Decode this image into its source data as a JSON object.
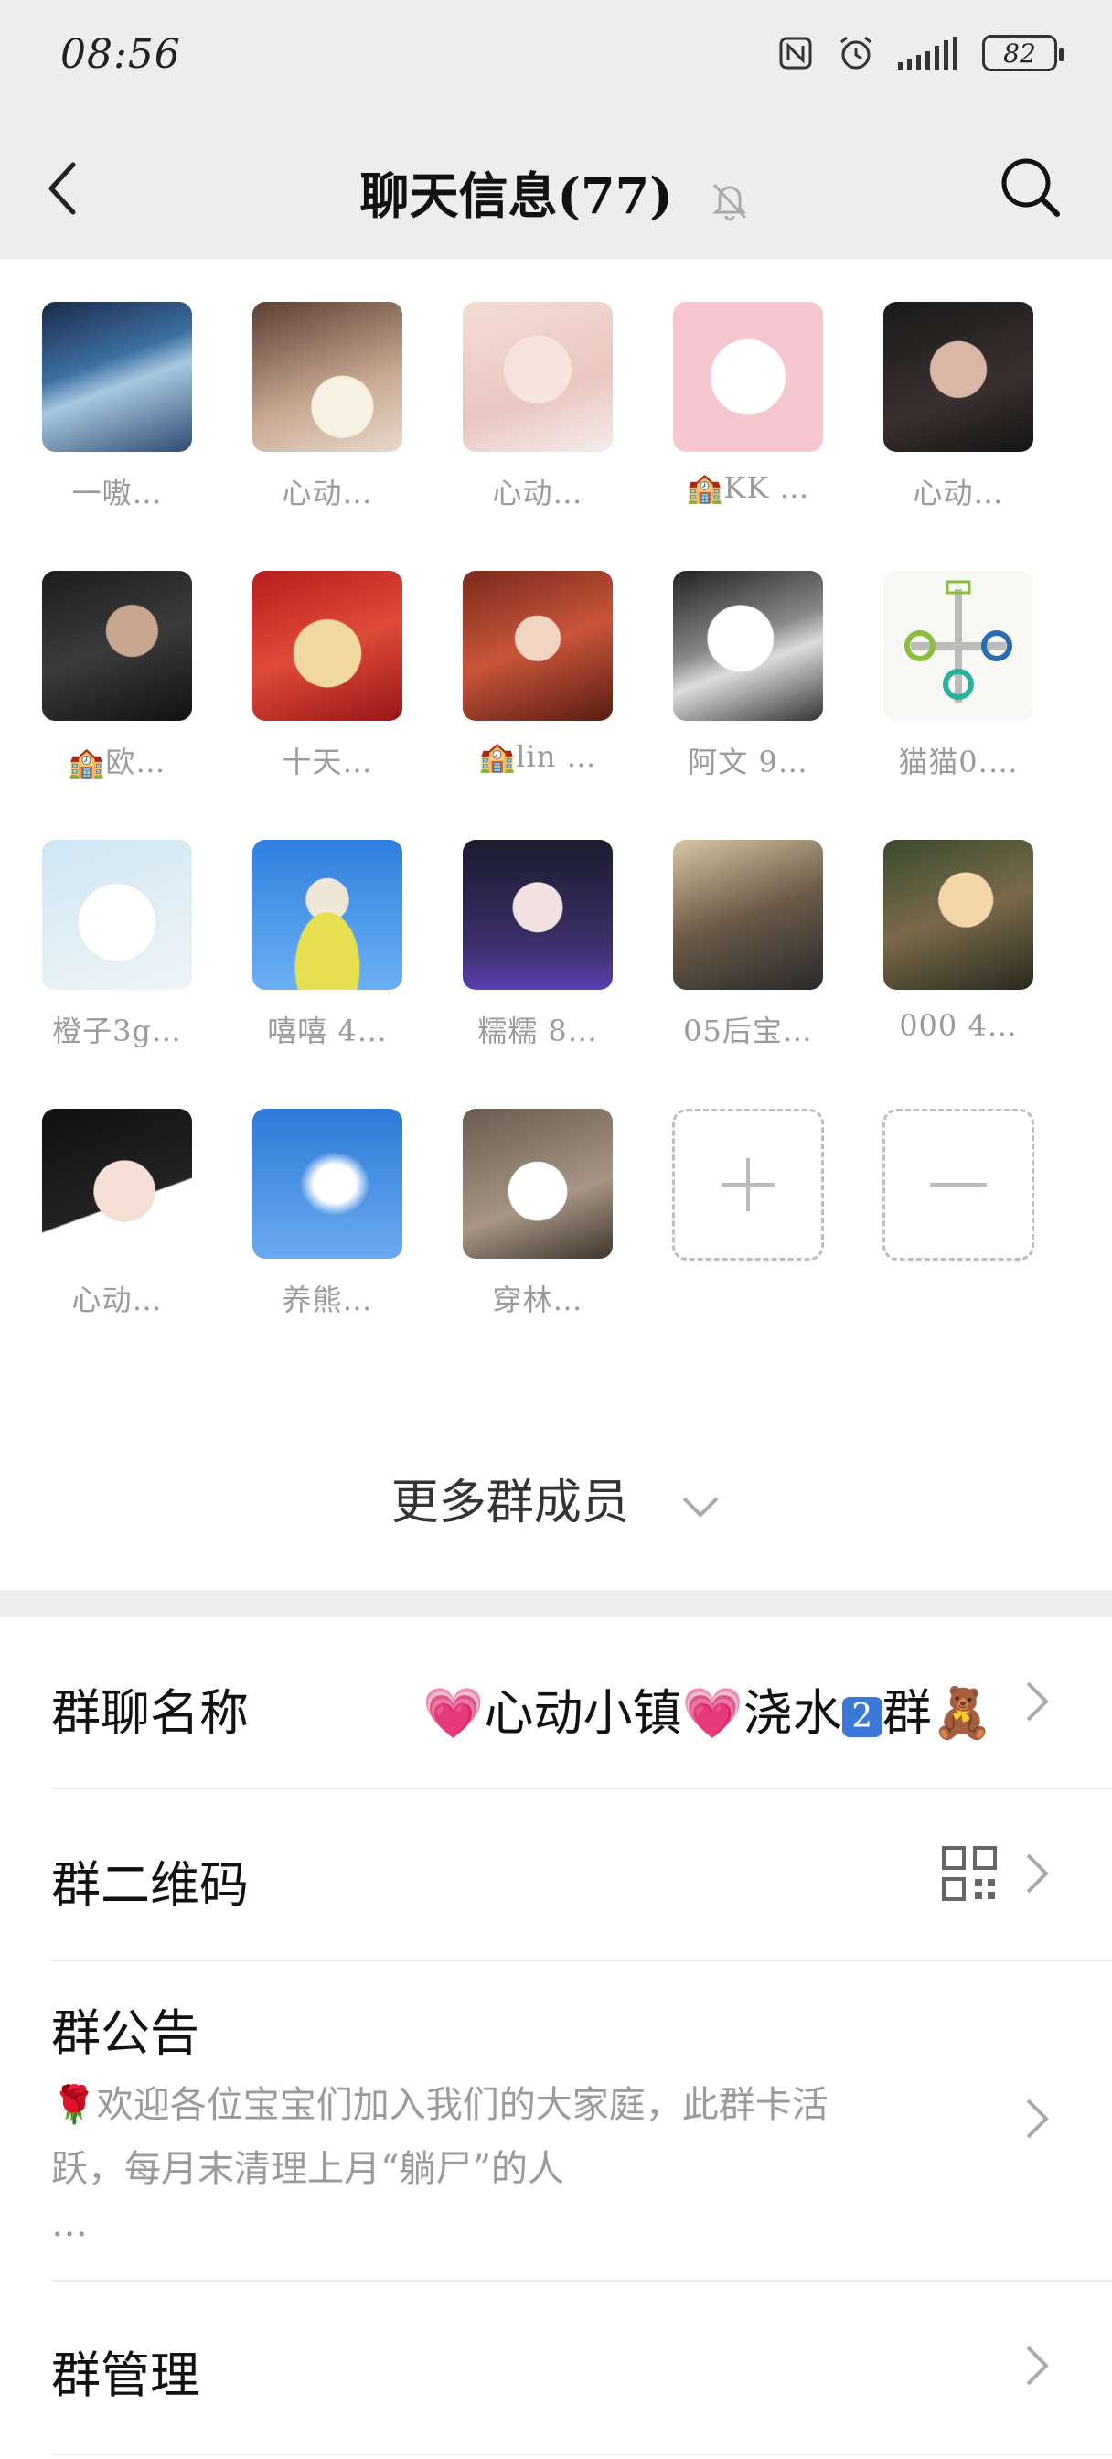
{
  "status": {
    "time": "08:56",
    "battery": "82"
  },
  "header": {
    "title": "聊天信息(77)"
  },
  "members": [
    {
      "name": "一嗷…",
      "badge": ""
    },
    {
      "name": "心动…",
      "badge": ""
    },
    {
      "name": "心动…",
      "badge": ""
    },
    {
      "name": "KK …",
      "badge": "🏫"
    },
    {
      "name": "心动…",
      "badge": ""
    },
    {
      "name": "欧…",
      "badge": "🏫"
    },
    {
      "name": "十天…",
      "badge": ""
    },
    {
      "name": "lin …",
      "badge": "🏫"
    },
    {
      "name": "阿文 9…",
      "badge": ""
    },
    {
      "name": "猫猫0.…",
      "badge": ""
    },
    {
      "name": "橙子3g…",
      "badge": ""
    },
    {
      "name": "嘻嘻 4…",
      "badge": ""
    },
    {
      "name": "糯糯 8…",
      "badge": ""
    },
    {
      "name": "05后宝…",
      "badge": ""
    },
    {
      "name": "000 4…",
      "badge": ""
    },
    {
      "name": "心动…",
      "badge": ""
    },
    {
      "name": "养熊…",
      "badge": ""
    },
    {
      "name": "穿林…",
      "badge": ""
    }
  ],
  "more_members": "更多群成员",
  "group_name": {
    "label": "群聊名称",
    "value_a": "💗心动小镇💗浇水",
    "value_num": "2",
    "value_b": "群🧸"
  },
  "qr": {
    "label": "群二维码"
  },
  "notice": {
    "label": "群公告",
    "text_line1": "🌹欢迎各位宝宝们加入我们的大家庭，此群卡活",
    "text_line2": "跃，每月末清理上月“躺尸”的人",
    "text_line3": "…"
  },
  "manage": {
    "label": "群管理"
  },
  "icons": [
    "back-icon",
    "bell-muted-icon",
    "search-icon",
    "nfc-icon",
    "alarm-icon",
    "signal-icon",
    "battery-icon",
    "add-member-icon",
    "remove-member-icon",
    "chevron-down-icon",
    "chevron-right-icon",
    "qr-code-icon"
  ]
}
